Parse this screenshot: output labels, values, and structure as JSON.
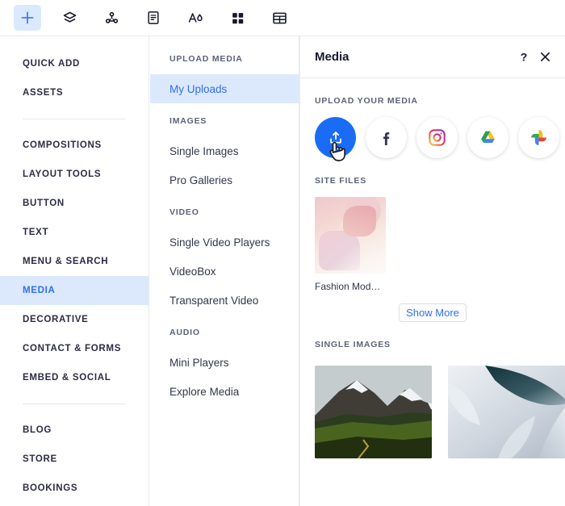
{
  "toolbar": {
    "items": [
      {
        "name": "add-element",
        "icon": "plus-icon",
        "active": true
      },
      {
        "name": "layers",
        "icon": "layers-icon",
        "active": false
      },
      {
        "name": "apps",
        "icon": "molecule-icon",
        "active": false
      },
      {
        "name": "pages",
        "icon": "page-icon",
        "active": false
      },
      {
        "name": "theme",
        "icon": "theme-icon",
        "active": false
      },
      {
        "name": "grid-apps",
        "icon": "grid-icon",
        "active": false
      },
      {
        "name": "table",
        "icon": "table-icon",
        "active": false
      }
    ]
  },
  "sidebar": {
    "groups": [
      {
        "items": [
          {
            "label": "QUICK ADD",
            "active": false
          },
          {
            "label": "ASSETS",
            "active": false
          }
        ]
      },
      {
        "items": [
          {
            "label": "COMPOSITIONS",
            "active": false
          },
          {
            "label": "LAYOUT TOOLS",
            "active": false
          },
          {
            "label": "BUTTON",
            "active": false
          },
          {
            "label": "TEXT",
            "active": false
          },
          {
            "label": "MENU & SEARCH",
            "active": false
          },
          {
            "label": "MEDIA",
            "active": true
          },
          {
            "label": "DECORATIVE",
            "active": false
          },
          {
            "label": "CONTACT & FORMS",
            "active": false
          },
          {
            "label": "EMBED & SOCIAL",
            "active": false
          }
        ]
      },
      {
        "items": [
          {
            "label": "BLOG",
            "active": false
          },
          {
            "label": "STORE",
            "active": false
          },
          {
            "label": "BOOKINGS",
            "active": false
          }
        ]
      }
    ]
  },
  "midcol": {
    "sections": [
      {
        "heading": "UPLOAD MEDIA",
        "items": [
          {
            "label": "My Uploads",
            "active": true
          }
        ]
      },
      {
        "heading": "IMAGES",
        "items": [
          {
            "label": "Single Images",
            "active": false
          },
          {
            "label": "Pro Galleries",
            "active": false
          }
        ]
      },
      {
        "heading": "VIDEO",
        "items": [
          {
            "label": "Single Video Players",
            "active": false
          },
          {
            "label": "VideoBox",
            "active": false
          },
          {
            "label": "Transparent Video",
            "active": false
          }
        ]
      },
      {
        "heading": "AUDIO",
        "items": [
          {
            "label": "Mini Players",
            "active": false
          },
          {
            "label": "Explore Media",
            "active": false
          }
        ]
      }
    ]
  },
  "panel": {
    "title": "Media",
    "help_icon": "?",
    "close_icon": "✕",
    "upload_section": {
      "heading": "UPLOAD YOUR MEDIA",
      "sources": [
        {
          "name": "upload-from-computer",
          "icon": "upload-icon",
          "primary": true,
          "hovered": true
        },
        {
          "name": "facebook",
          "icon": "facebook-icon",
          "primary": false,
          "hovered": false
        },
        {
          "name": "instagram",
          "icon": "instagram-icon",
          "primary": false,
          "hovered": false
        },
        {
          "name": "google-drive",
          "icon": "google-drive-icon",
          "primary": false,
          "hovered": false
        },
        {
          "name": "google-photos",
          "icon": "google-photos-icon",
          "primary": false,
          "hovered": false
        }
      ]
    },
    "site_files": {
      "heading": "SITE FILES",
      "files": [
        {
          "name": "Fashion Mod…",
          "thumb": "fashion-model-pink"
        }
      ],
      "show_more_label": "Show More"
    },
    "single_images": {
      "heading": "SINGLE IMAGES",
      "images": [
        {
          "name": "mountain-landscape"
        },
        {
          "name": "abstract-gradient"
        }
      ]
    }
  },
  "colors": {
    "accent": "#2f6ef5",
    "accent_strong": "#1b6cf5",
    "highlight_bg": "#dce9fd",
    "text": "#2b2b44",
    "muted": "#5a6377",
    "border": "#e8eaef"
  }
}
